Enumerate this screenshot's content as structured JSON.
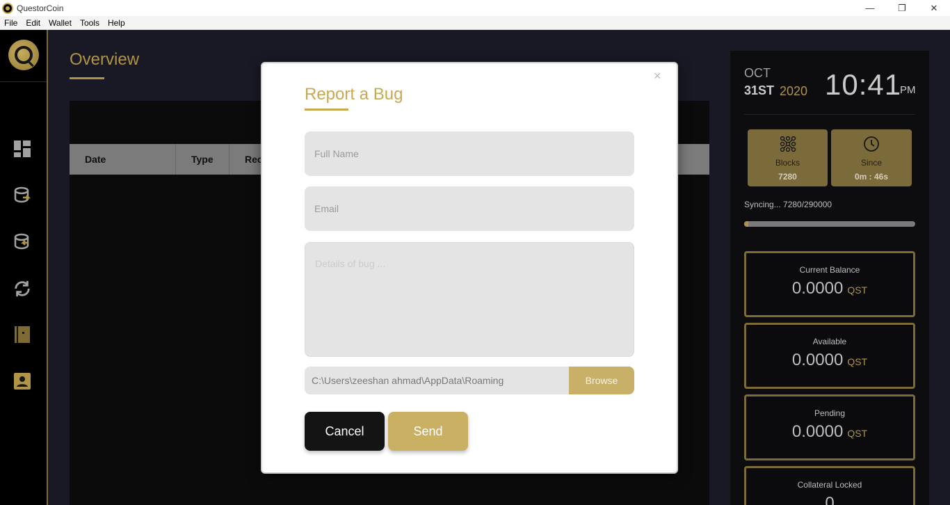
{
  "window": {
    "title": "QuestorCoin",
    "minimize_icon": "—",
    "restore_icon": "❐",
    "close_icon": "✕"
  },
  "menu": [
    "File",
    "Edit",
    "Wallet",
    "Tools",
    "Help"
  ],
  "sidebar": {
    "items": [
      {
        "name": "dashboard-icon"
      },
      {
        "name": "send-coins-icon"
      },
      {
        "name": "receive-coins-icon"
      },
      {
        "name": "sync-icon"
      },
      {
        "name": "address-book-icon"
      },
      {
        "name": "contact-icon"
      }
    ]
  },
  "main": {
    "title": "Overview",
    "table": {
      "columns": [
        "Date",
        "Type",
        "Rec"
      ]
    }
  },
  "datetime": {
    "month": "OCT",
    "day": "31ST",
    "year": "2020",
    "time": "10:41",
    "ampm": "PM"
  },
  "stats": [
    {
      "label": "Blocks",
      "value": "7280",
      "icon": "blocks-icon"
    },
    {
      "label": "Since",
      "value": "0m : 46s",
      "icon": "clock-icon"
    }
  ],
  "sync": {
    "text": "Syncing...  7280/290000",
    "progress_fraction": 0.025
  },
  "balances": [
    {
      "label": "Current Balance",
      "amount": "0.0000",
      "unit": "QST"
    },
    {
      "label": "Available",
      "amount": "0.0000",
      "unit": "QST"
    },
    {
      "label": "Pending",
      "amount": "0.0000",
      "unit": "QST"
    },
    {
      "label": "Collateral Locked",
      "amount": "0",
      "unit": ""
    }
  ],
  "modal": {
    "title": "Report a Bug",
    "close_icon": "×",
    "full_name_placeholder": "Full Name",
    "email_placeholder": "Email",
    "details_placeholder": "Details of bug ...",
    "file_path": "C:\\Users\\zeeshan ahmad\\AppData\\Roaming",
    "browse_label": "Browse",
    "cancel_label": "Cancel",
    "send_label": "Send"
  },
  "colors": {
    "accent": "#c9a94f",
    "sidebar_bg": "#000000",
    "panel_bg": "#0f0f12"
  }
}
